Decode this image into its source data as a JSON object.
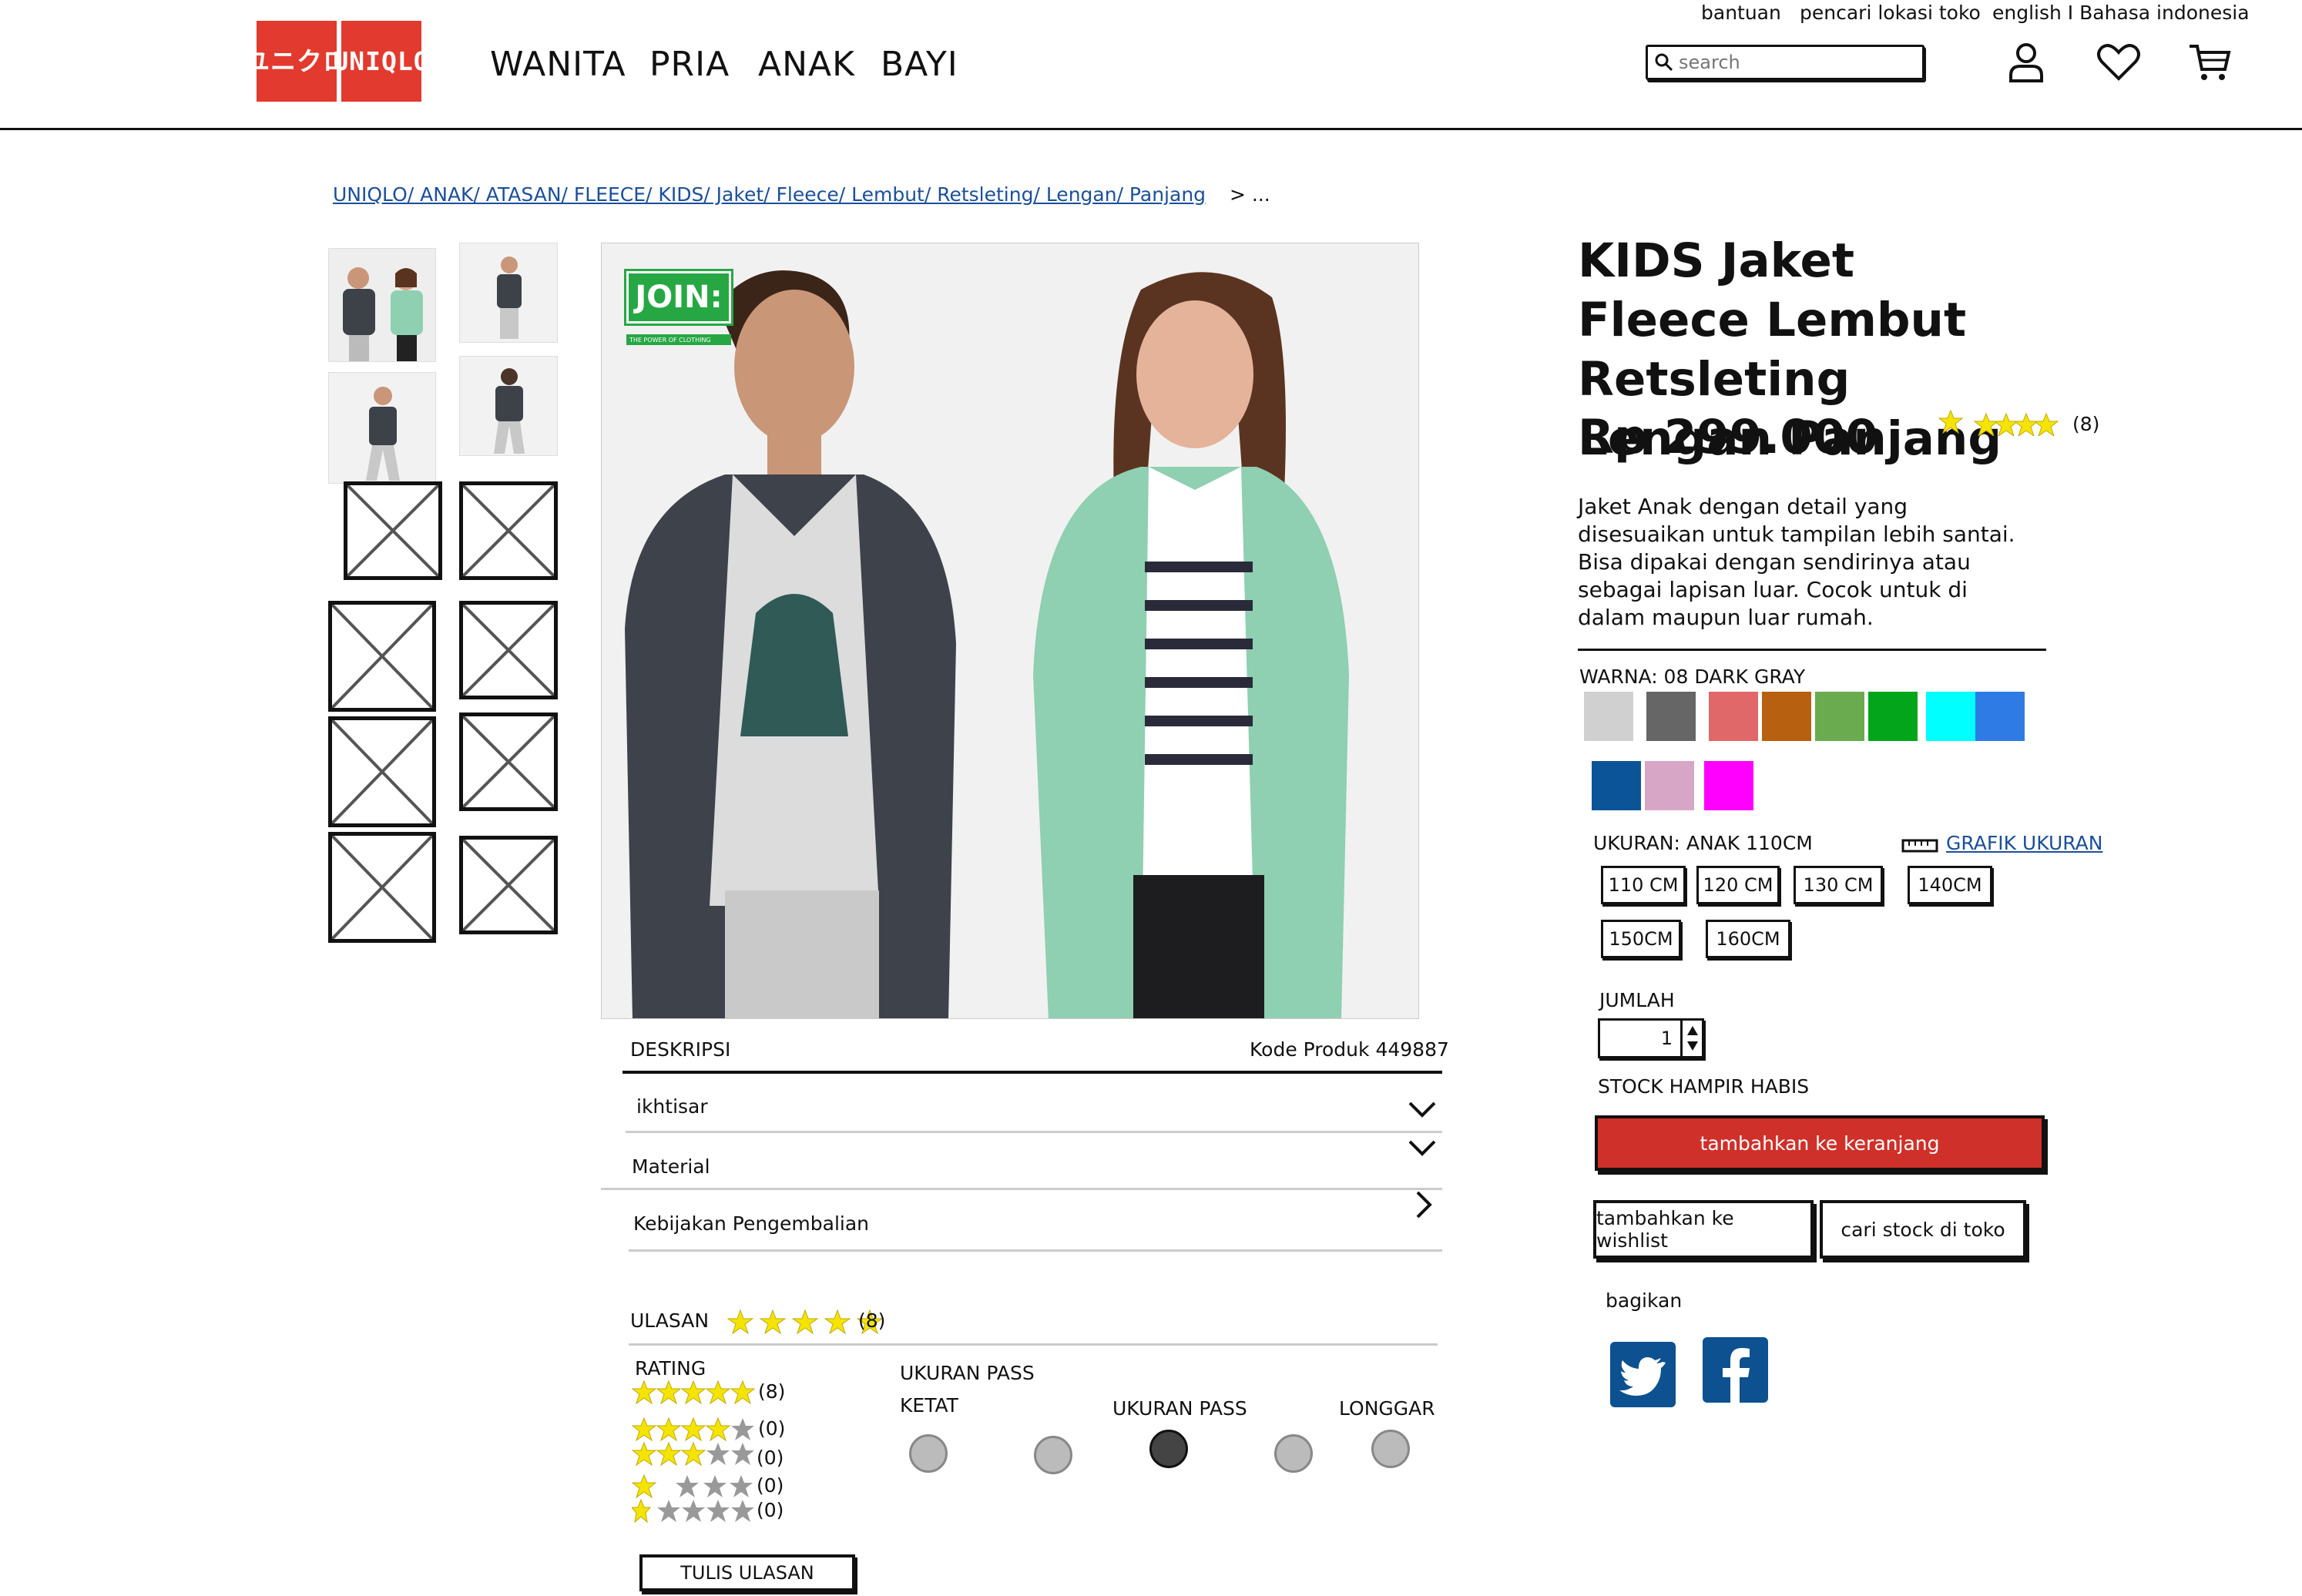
{
  "header": {
    "logo_top": "UNI",
    "logo_bottom": "QLO",
    "logo_left_top": "ユニ",
    "logo_left_bottom": "クロ",
    "nav": [
      "WANITA",
      "PRIA",
      "ANAK",
      "BAYI"
    ],
    "top_links": [
      "bantuan",
      "pencari lokasi toko",
      "english I Bahasa indonesia"
    ],
    "search_placeholder": "search",
    "icons": [
      "user-icon",
      "heart-icon",
      "cart-icon"
    ]
  },
  "breadcrumb": {
    "path": "UNIQLO/ ANAK/ ATASAN/ FLEECE/ KIDS/  Jaket/ Fleece/ Lembut/ Retsleting/ Lengan/ Panjang",
    "tail": "> ..."
  },
  "product": {
    "title": "KIDS Jaket Fleece Lembut Retsleting Lengan Panjang",
    "price": "Rp 299.000",
    "rating_count": "(8)",
    "description": "Jaket Anak dengan detail yang disesuaikan untuk tampilan lebih santai. Bisa dipakai dengan sendirinya atau sebagai lapisan luar. Cocok untuk di dalam maupun luar rumah.",
    "color_label": "WARNA: 08 DARK GRAY",
    "colors": [
      "#d0d0d0",
      "#666666",
      "#e16868",
      "#b7600f",
      "#6aab4f",
      "#03a51b",
      "#00ffff",
      "#2f7be6",
      "#0c5498",
      "#d7a6c7",
      "#ff00ff"
    ],
    "size_label": "UKURAN: ANAK 110CM",
    "size_chart_link": "GRAFIK UKURAN",
    "sizes": [
      "110 CM",
      "120 CM",
      "130 CM",
      "140CM",
      "150CM",
      "160CM"
    ],
    "qty_label": "JUMLAH",
    "qty_value": "1",
    "stock_note": "STOCK HAMPIR HABIS",
    "add_to_cart": "tambahkan ke keranjang",
    "add_to_wishlist": "tambahkan ke wishlist",
    "find_in_store": "cari stock di toko",
    "share_label": "bagikan"
  },
  "image": {
    "badge_text": "JOIN:",
    "badge_sub": "THE POWER OF CLOTHING"
  },
  "details": {
    "section_label": "DESKRIPSI",
    "product_code": "Kode Produk 449887",
    "rows": [
      "ikhtisar",
      "Material",
      "Kebijakan Pengembalian"
    ]
  },
  "reviews": {
    "label": "ULASAN",
    "count": "(8)",
    "rating_label": "RATING",
    "breakdown": [
      {
        "stars": 5,
        "count": "(8)"
      },
      {
        "stars": 4,
        "count": "(0)"
      },
      {
        "stars": 3,
        "count": "(0)"
      },
      {
        "stars": 1,
        "count": "(0)"
      },
      {
        "stars": 0,
        "count": "(0)"
      }
    ],
    "fit_title": "UKURAN PASS",
    "fit_left": "KETAT",
    "fit_mid": "UKURAN PASS",
    "fit_right": "LONGGAR",
    "fit_selected_index": 2,
    "write_review": "TULIS ULASAN"
  }
}
